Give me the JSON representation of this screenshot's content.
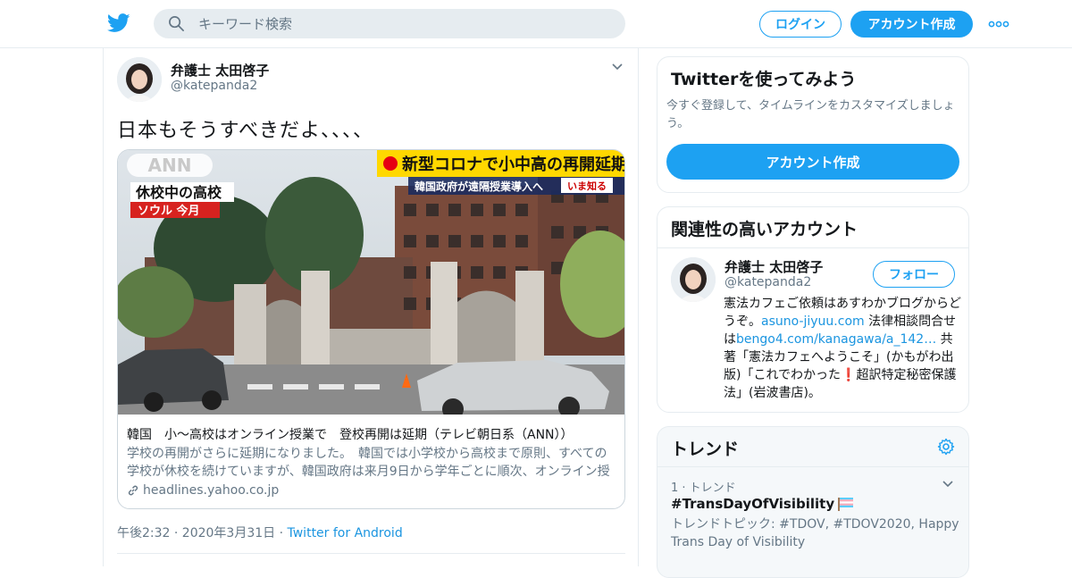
{
  "header": {
    "search_placeholder": "キーワード検索",
    "login_label": "ログイン",
    "signup_label": "アカウント作成"
  },
  "tweet": {
    "author_name": "弁護士 太田啓子",
    "author_handle": "@katepanda2",
    "text": "日本もそうすべきだよ、、、、",
    "card": {
      "image_overlay": {
        "network": "ANN",
        "headline": "新型コロナで小中高の再開延期",
        "subheadline": "韓国政府が遠隔授業導入へ",
        "badge": "いま知る",
        "scene": "休校中の高校",
        "place": "ソウル 今月"
      },
      "title": "韓国　小～高校はオンライン授業で　登校再開は延期（テレビ朝日系（ANN））",
      "description": "学校の再開がさらに延期になりました。　韓国では小学校から高校まで原則、すべての学校が休校を続けていますが、韓国政府は来月9日から学年ごとに順次、オンライン授業を始めると発表しました。",
      "domain": "headlines.yahoo.co.jp"
    },
    "time": "午後2:32 · 2020年3月31日",
    "separator": " · ",
    "source": "Twitter for Android"
  },
  "try_twitter": {
    "heading": "Twitterを使ってみよう",
    "subtitle": "今すぐ登録して、タイムラインをカスタマイズしましょう。",
    "cta_label": "アカウント作成"
  },
  "related": {
    "heading": "関連性の高いアカウント",
    "account": {
      "name": "弁護士 太田啓子",
      "handle": "@katepanda2",
      "follow_label": "フォロー",
      "bio_1": "憲法カフェご依頼はあすわかブログからどうぞ。",
      "bio_link_1": "asuno-jiyuu.com",
      "bio_2": " 法律相談問合せは",
      "bio_link_2": "bengo4.com/kanagawa/a_142…",
      "bio_3": " 共著「憲法カフェへようこそ」(かもがわ出版)「これでわかった",
      "bio_emoji": "❗",
      "bio_4": "超訳特定秘密保護法」(岩波書店)。"
    }
  },
  "trends": {
    "heading": "トレンド",
    "items": [
      {
        "meta": "1 · トレンド",
        "tag": "#TransDayOfVisibility",
        "topic": "トレンドトピック: #TDOV, #TDOV2020, Happy Trans Day of Visibility"
      }
    ]
  },
  "colors": {
    "accent": "#1da1f2",
    "link": "#1b95e0",
    "muted": "#657786",
    "border": "#e6ecf0"
  },
  "icons": [
    "twitter-bird-icon",
    "search-icon",
    "more-dots-icon",
    "chevron-down-icon",
    "link-icon",
    "gear-icon",
    "trans-flag-icon"
  ]
}
